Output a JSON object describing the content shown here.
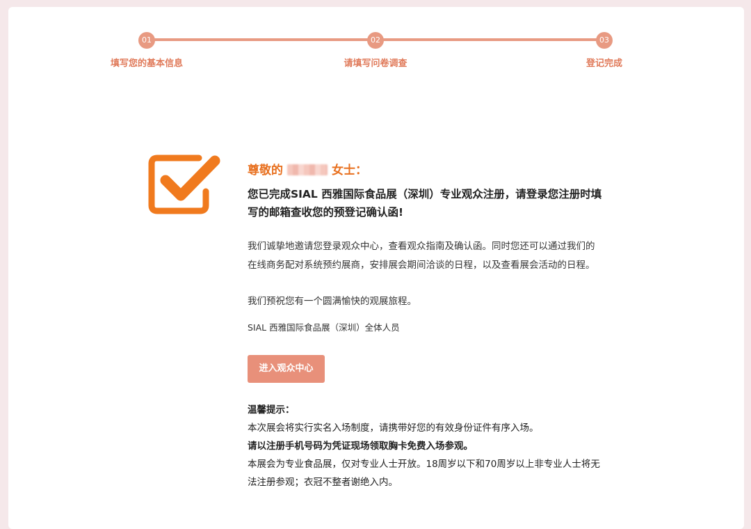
{
  "steps": [
    {
      "number": "01",
      "label": "填写您的基本信息"
    },
    {
      "number": "02",
      "label": "请填写问卷调查"
    },
    {
      "number": "03",
      "label": "登记完成"
    }
  ],
  "colors": {
    "accent": "#e89a82",
    "orange": "#e8701f",
    "button": "#e8907a",
    "background": "#f5e8ea"
  },
  "icon": "check-square-icon",
  "greeting": {
    "prefix": "尊敬的",
    "suffix": "女士："
  },
  "headline": "您已完成SIAL 西雅国际食品展（深圳）专业观众注册，请登录您注册时填写的邮箱查收您的预登记确认函!",
  "paragraph1": "我们诚挚地邀请您登录观众中心，查看观众指南及确认函。同时您还可以通过我们的在线商务配对系统预约展商，安排展会期间洽谈的日程，以及查看展会活动的日程。",
  "paragraph2": "我们预祝您有一个圆满愉快的观展旅程。",
  "signature": "SIAL 西雅国际食品展（深圳）全体人员",
  "button_label": "进入观众中心",
  "tips": {
    "title": "温馨提示：",
    "line1": "本次展会将实行实名入场制度，请携带好您的有效身份证件有序入场。",
    "line2": "请以注册手机号码为凭证现场领取胸卡免费入场参观。",
    "line3": "本展会为专业食品展，仅对专业人士开放。18周岁以下和70周岁以上非专业人士将无法注册参观；衣冠不整者谢绝入内。"
  }
}
